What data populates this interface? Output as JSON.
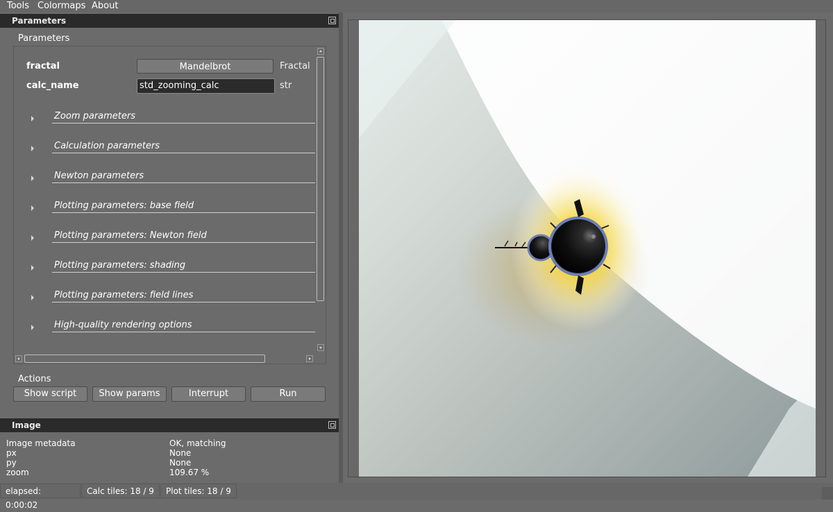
{
  "menu": [
    "Tools",
    "Colormaps",
    "About"
  ],
  "parameters_dock": {
    "title": "Parameters",
    "group_title": "Parameters",
    "fractal": {
      "label": "fractal",
      "value": "Mandelbrot",
      "type": "Fractal"
    },
    "calc_name": {
      "label": "calc_name",
      "value": "std_zooming_calc",
      "type": "str"
    },
    "sections": [
      "Zoom parameters",
      "Calculation parameters",
      "Newton parameters",
      "Plotting parameters: base field",
      "Plotting parameters: Newton field",
      "Plotting parameters: shading",
      "Plotting parameters: field lines",
      "High-quality rendering options"
    ],
    "actions_title": "Actions",
    "actions": [
      "Show script",
      "Show params",
      "Interrupt",
      "Run"
    ]
  },
  "image_dock": {
    "title": "Image",
    "rows": [
      {
        "key": "Image metadata",
        "value": "OK, matching"
      },
      {
        "key": "px",
        "value": "None"
      },
      {
        "key": "py",
        "value": "None"
      },
      {
        "key": "zoom",
        "value": "109.67 %"
      }
    ]
  },
  "status": {
    "elapsed": "elapsed: 0:00:02",
    "calc_tiles": "Calc tiles: 18 / 9",
    "plot_tiles": "Plot tiles: 18 / 9"
  },
  "colors": {
    "background": "#6b6b6b",
    "dock_title": "#2a2a2a",
    "input_bg": "#2b2b2b",
    "fractal_gold": "#f2c21a",
    "fractal_outside": "#a7b0ac"
  }
}
